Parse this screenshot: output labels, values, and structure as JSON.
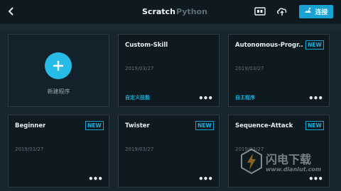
{
  "header": {
    "tabs": [
      {
        "label": "Scratch",
        "active": true
      },
      {
        "label": "Python",
        "active": false
      }
    ],
    "connect_label": "连接",
    "accent": "#18a3d2"
  },
  "new_program": {
    "label": "新建程序"
  },
  "cards": [
    {
      "title": "Custom-Skill",
      "date": "2019/03/27",
      "tag": "自定义技能",
      "badge": ""
    },
    {
      "title": "Autonomous-Progr...",
      "date": "2019/03/27",
      "tag": "自主程序",
      "badge": "NEW"
    },
    {
      "title": "Beginner",
      "date": "2019/03/27",
      "tag": "",
      "badge": "NEW"
    },
    {
      "title": "Twister",
      "date": "2019/03/27",
      "tag": "",
      "badge": "NEW"
    },
    {
      "title": "Sequence-Attack",
      "date": "2019/03/27",
      "tag": "",
      "badge": "NEW"
    }
  ],
  "more_label": "•••",
  "watermark": {
    "name": "闪电下载",
    "url": "www.dianlut.com"
  }
}
